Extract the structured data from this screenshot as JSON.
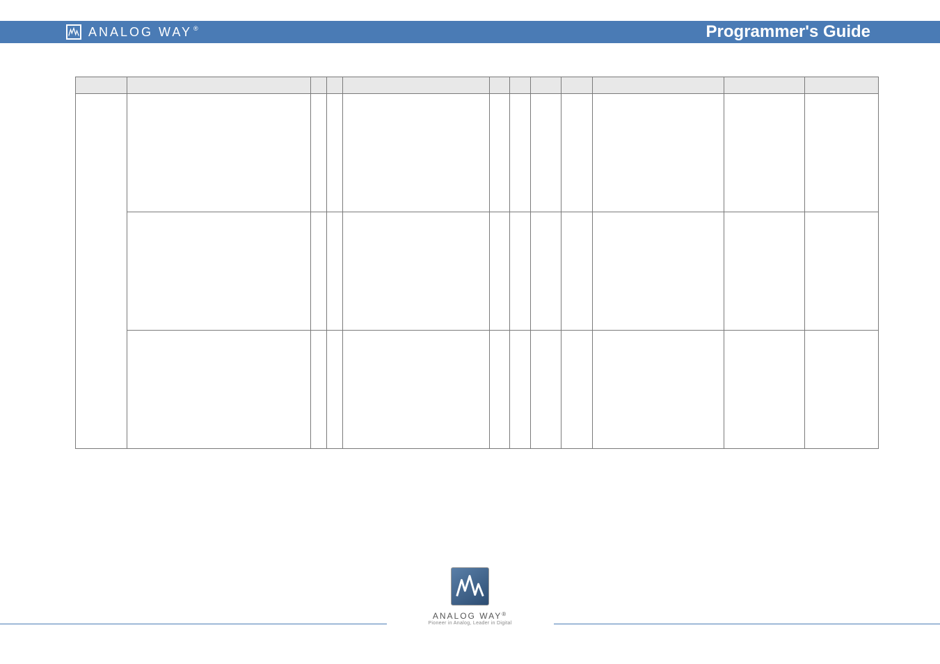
{
  "header": {
    "brand": "ANALOG WAY",
    "registered": "®",
    "title": "Programmer's Guide"
  },
  "table": {
    "headers": [
      "",
      "",
      "",
      "",
      "",
      "",
      "",
      "",
      "",
      "",
      "",
      ""
    ],
    "rows": [
      {
        "cells": [
          "",
          "",
          "",
          "",
          "",
          "",
          "",
          "",
          "",
          "",
          "",
          ""
        ]
      },
      {
        "cells": [
          "",
          "",
          "",
          "",
          "",
          "",
          "",
          "",
          "",
          "",
          "",
          ""
        ]
      },
      {
        "cells": [
          "",
          "",
          "",
          "",
          "",
          "",
          "",
          "",
          "",
          "",
          "",
          ""
        ]
      }
    ]
  },
  "footer": {
    "brand": "ANALOG WAY",
    "registered": "®",
    "tagline": "Pioneer in Analog, Leader in Digital"
  }
}
